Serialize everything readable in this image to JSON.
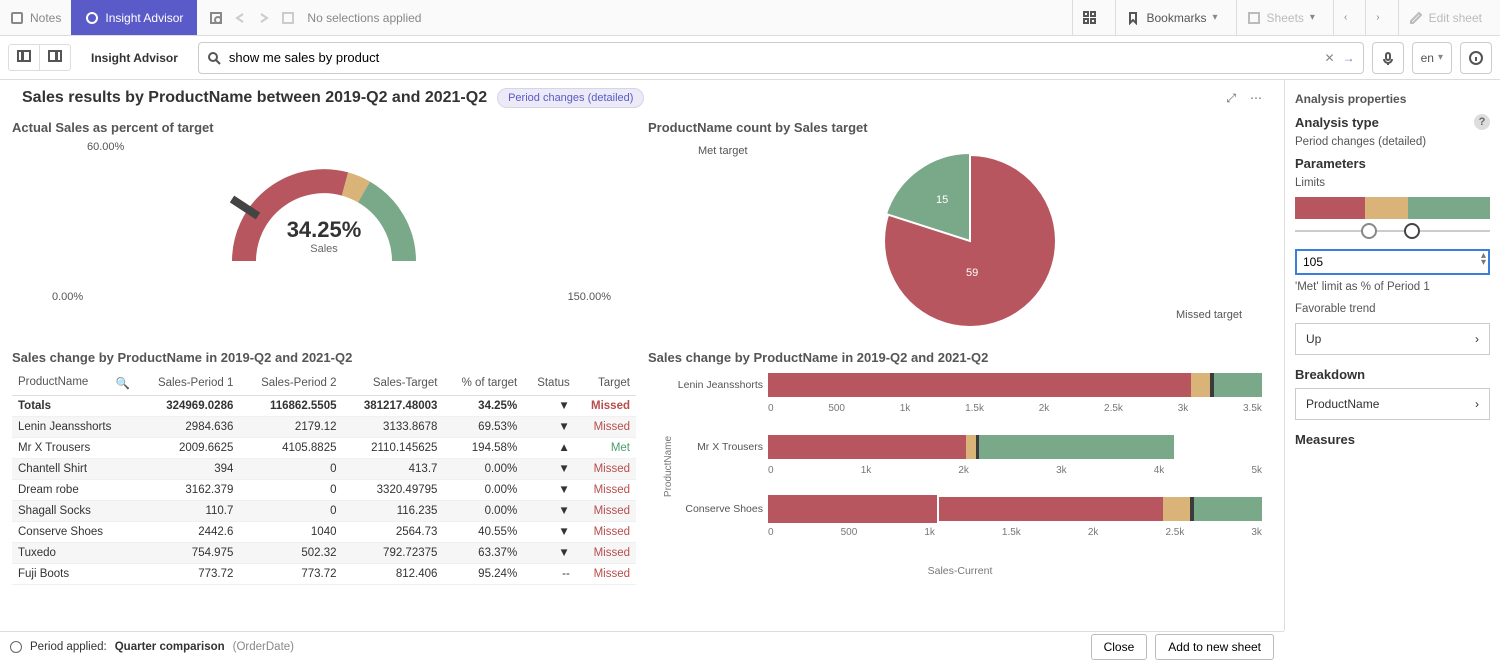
{
  "topbar": {
    "notes_label": "Notes",
    "insight_label": "Insight Advisor",
    "no_selection": "No selections applied",
    "bookmarks_label": "Bookmarks",
    "sheets_label": "Sheets",
    "edit_sheet_label": "Edit sheet"
  },
  "secbar": {
    "title": "Insight Advisor",
    "search_value": "show me sales by product",
    "lang": "en"
  },
  "analysis": {
    "title": "Sales results by ProductName between 2019-Q2 and 2021-Q2",
    "badge": "Period changes (detailed)"
  },
  "gauge": {
    "title": "Actual Sales as percent of target",
    "min": "0.00%",
    "mid": "60.00%",
    "max": "150.00%",
    "value": "34.25%",
    "value_sub": "Sales"
  },
  "pie": {
    "title": "ProductName count by Sales target",
    "met_label": "Met target",
    "met_value": "15",
    "missed_label": "Missed target",
    "missed_value": "59"
  },
  "table": {
    "title": "Sales change by ProductName in 2019-Q2 and 2021-Q2",
    "cols": [
      "ProductName",
      "Sales-Period 1",
      "Sales-Period 2",
      "Sales-Target",
      "% of target",
      "Status",
      "Target"
    ],
    "totals": {
      "name": "Totals",
      "p1": "324969.0286",
      "p2": "116862.5505",
      "st": "381217.48003",
      "pct": "34.25%",
      "stat": "▼",
      "tgt": "Missed"
    },
    "rows": [
      {
        "name": "Lenin Jeansshorts",
        "p1": "2984.636",
        "p2": "2179.12",
        "st": "3133.8678",
        "pct": "69.53%",
        "stat": "▼",
        "tgt": "Missed"
      },
      {
        "name": "Mr X Trousers",
        "p1": "2009.6625",
        "p2": "4105.8825",
        "st": "2110.145625",
        "pct": "194.58%",
        "stat": "▲",
        "tgt": "Met"
      },
      {
        "name": "Chantell Shirt",
        "p1": "394",
        "p2": "0",
        "st": "413.7",
        "pct": "0.00%",
        "stat": "▼",
        "tgt": "Missed"
      },
      {
        "name": "Dream robe",
        "p1": "3162.379",
        "p2": "0",
        "st": "3320.49795",
        "pct": "0.00%",
        "stat": "▼",
        "tgt": "Missed"
      },
      {
        "name": "Shagall Socks",
        "p1": "110.7",
        "p2": "0",
        "st": "116.235",
        "pct": "0.00%",
        "stat": "▼",
        "tgt": "Missed"
      },
      {
        "name": "Conserve Shoes",
        "p1": "2442.6",
        "p2": "1040",
        "st": "2564.73",
        "pct": "40.55%",
        "stat": "▼",
        "tgt": "Missed"
      },
      {
        "name": "Tuxedo",
        "p1": "754.975",
        "p2": "502.32",
        "st": "792.72375",
        "pct": "63.37%",
        "stat": "▼",
        "tgt": "Missed"
      },
      {
        "name": "Fuji Boots",
        "p1": "773.72",
        "p2": "773.72",
        "st": "812.406",
        "pct": "95.24%",
        "stat": "--",
        "tgt": "Missed"
      }
    ]
  },
  "barchart": {
    "title": "Sales change by ProductName in 2019-Q2 and 2021-Q2",
    "ylabel": "ProductName",
    "xlabel": "Sales-Current",
    "rows": [
      {
        "name": "Lenin Jeansshorts",
        "ticks": [
          "0",
          "500",
          "1k",
          "1.5k",
          "2k",
          "2.5k",
          "3k",
          "3.5k"
        ],
        "max": 3500,
        "segs": [
          {
            "c": "#b7565e",
            "a": 0,
            "b": 3000
          },
          {
            "c": "#d9b377",
            "a": 3000,
            "b": 3133
          },
          {
            "c": "#3b3b3b",
            "a": 3133,
            "b": 3160
          },
          {
            "c": "#7aa989",
            "a": 3160,
            "b": 3500
          }
        ]
      },
      {
        "name": "Mr X Trousers",
        "ticks": [
          "0",
          "1k",
          "2k",
          "3k",
          "4k",
          "5k"
        ],
        "max": 5000,
        "segs": [
          {
            "c": "#b7565e",
            "a": 0,
            "b": 2000
          },
          {
            "c": "#d9b377",
            "a": 2000,
            "b": 2110
          },
          {
            "c": "#3b3b3b",
            "a": 2110,
            "b": 2140
          },
          {
            "c": "#7aa989",
            "a": 2140,
            "b": 4105
          }
        ]
      },
      {
        "name": "Conserve Shoes",
        "ticks": [
          "0",
          "500",
          "1k",
          "1.5k",
          "2k",
          "2.5k",
          "3k"
        ],
        "max": 3000,
        "segs": [
          {
            "c": "#b7565e",
            "a": 0,
            "b": 2400
          },
          {
            "c": "#d9b377",
            "a": 2400,
            "b": 2564
          },
          {
            "c": "#3b3b3b",
            "a": 2564,
            "b": 2590
          },
          {
            "c": "#7aa989",
            "a": 2590,
            "b": 3000
          }
        ],
        "sig": 1040
      }
    ]
  },
  "props": {
    "header": "Analysis properties",
    "type_head": "Analysis type",
    "type_val": "Period changes (detailed)",
    "params_head": "Parameters",
    "limits_label": "Limits",
    "limit_input": "105",
    "limit_hint": "'Met' limit as % of Period 1",
    "trend_head": "Favorable trend",
    "trend_val": "Up",
    "breakdown_head": "Breakdown",
    "breakdown_val": "ProductName",
    "measures_head": "Measures"
  },
  "footer": {
    "period_label": "Period applied:",
    "period_val": "Quarter comparison",
    "period_dim": "(OrderDate)",
    "close": "Close",
    "add": "Add to new sheet"
  },
  "colors": {
    "red": "#b7565e",
    "amber": "#d9b377",
    "green": "#7aa989",
    "accent": "#5a5ac9"
  },
  "chart_data": [
    {
      "type": "pie",
      "title": "Actual Sales as percent of target",
      "kind": "gauge",
      "value": 34.25,
      "unit": "%",
      "range": [
        0,
        150
      ],
      "bands": [
        {
          "from": 0,
          "to": 60,
          "color": "#b7565e"
        },
        {
          "from": 60,
          "to": 100,
          "color": "#d9b377"
        },
        {
          "from": 100,
          "to": 150,
          "color": "#7aa989"
        }
      ]
    },
    {
      "type": "pie",
      "title": "ProductName count by Sales target",
      "series": [
        {
          "name": "Met target",
          "value": 15,
          "color": "#7aa989"
        },
        {
          "name": "Missed target",
          "value": 59,
          "color": "#b7565e"
        }
      ]
    },
    {
      "type": "table",
      "title": "Sales change by ProductName in 2019-Q2 and 2021-Q2",
      "columns": [
        "ProductName",
        "Sales-Period 1",
        "Sales-Period 2",
        "Sales-Target",
        "% of target",
        "Status",
        "Target"
      ]
    },
    {
      "type": "bar",
      "title": "Sales change by ProductName in 2019-Q2 and 2021-Q2",
      "orientation": "horizontal",
      "xlabel": "Sales-Current",
      "ylabel": "ProductName",
      "categories": [
        "Lenin Jeansshorts",
        "Mr X Trousers",
        "Conserve Shoes"
      ],
      "series": [
        {
          "name": "Sales-Period 1",
          "values": [
            2984.636,
            2009.6625,
            2442.6
          ]
        },
        {
          "name": "Sales-Period 2",
          "values": [
            2179.12,
            4105.8825,
            1040
          ]
        },
        {
          "name": "Sales-Target",
          "values": [
            3133.8678,
            2110.145625,
            2564.73
          ]
        }
      ]
    }
  ]
}
